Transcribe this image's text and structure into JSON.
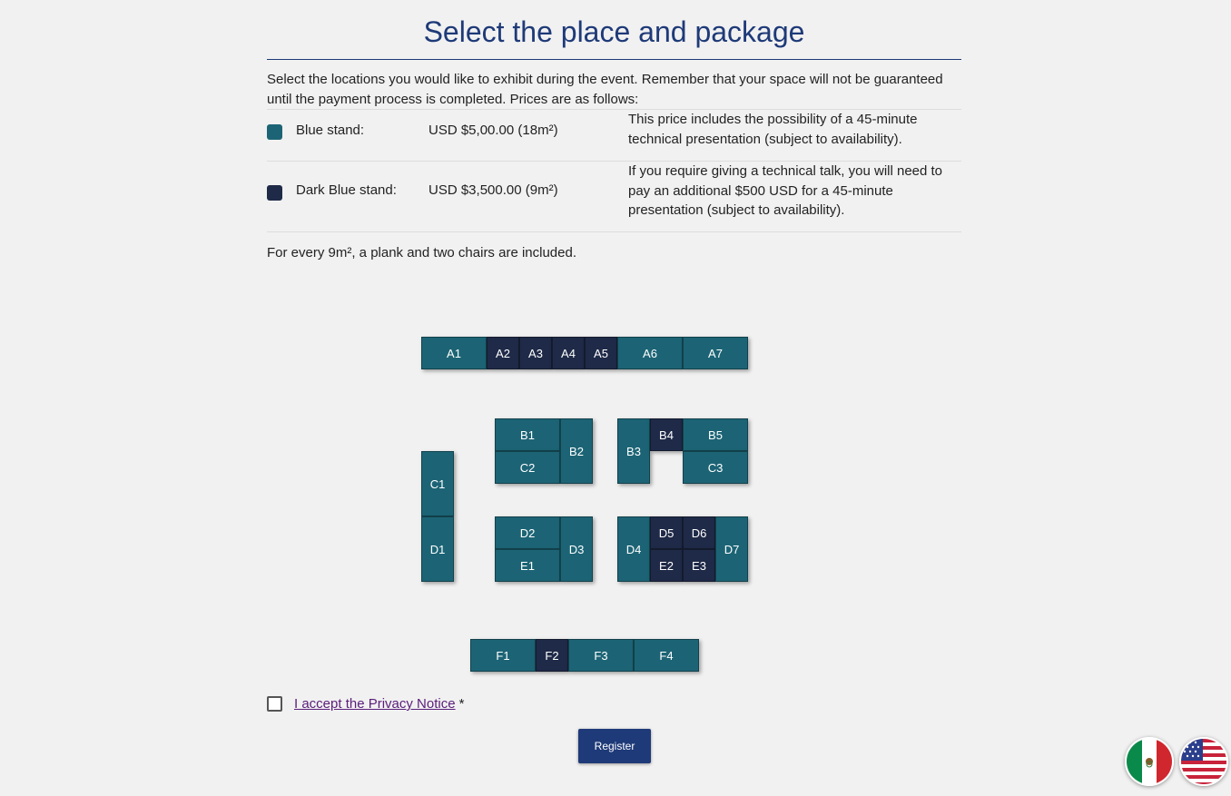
{
  "title": "Select the place and package",
  "intro": "Select the locations you would like to exhibit during the event. Remember that your space will not be guaranteed until the payment process is completed. Prices are as follows:",
  "prices": [
    {
      "name": "Blue stand:",
      "amount": "USD $5,00.00 (18m²)",
      "note": "This price includes the possibility of a 45-minute technical presentation (subject to availability).",
      "color": "#1c6475"
    },
    {
      "name": "Dark Blue stand:",
      "amount": "USD $3,500.00 (9m²)",
      "note": "If you require giving a technical talk, you will need to pay an additional $500 USD for a 45-minute presentation (subject to availability).",
      "color": "#1f2a48"
    }
  ],
  "footnote": "For every 9m², a plank and two chairs are included.",
  "booths": {
    "A1": "A1",
    "A2": "A2",
    "A3": "A3",
    "A4": "A4",
    "A5": "A5",
    "A6": "A6",
    "A7": "A7",
    "B1": "B1",
    "B2": "B2",
    "B3": "B3",
    "B4": "B4",
    "B5": "B5",
    "C1": "C1",
    "C2": "C2",
    "C3": "C3",
    "D1": "D1",
    "D2": "D2",
    "D3": "D3",
    "D4": "D4",
    "D5": "D5",
    "D6": "D6",
    "D7": "D7",
    "E1": "E1",
    "E2": "E2",
    "E3": "E3",
    "F1": "F1",
    "F2": "F2",
    "F3": "F3",
    "F4": "F4"
  },
  "privacy": {
    "link": "I accept the Privacy Notice",
    "required": "*"
  },
  "register_label": "Register",
  "languages": [
    "mexico-flag",
    "usa-flag"
  ]
}
